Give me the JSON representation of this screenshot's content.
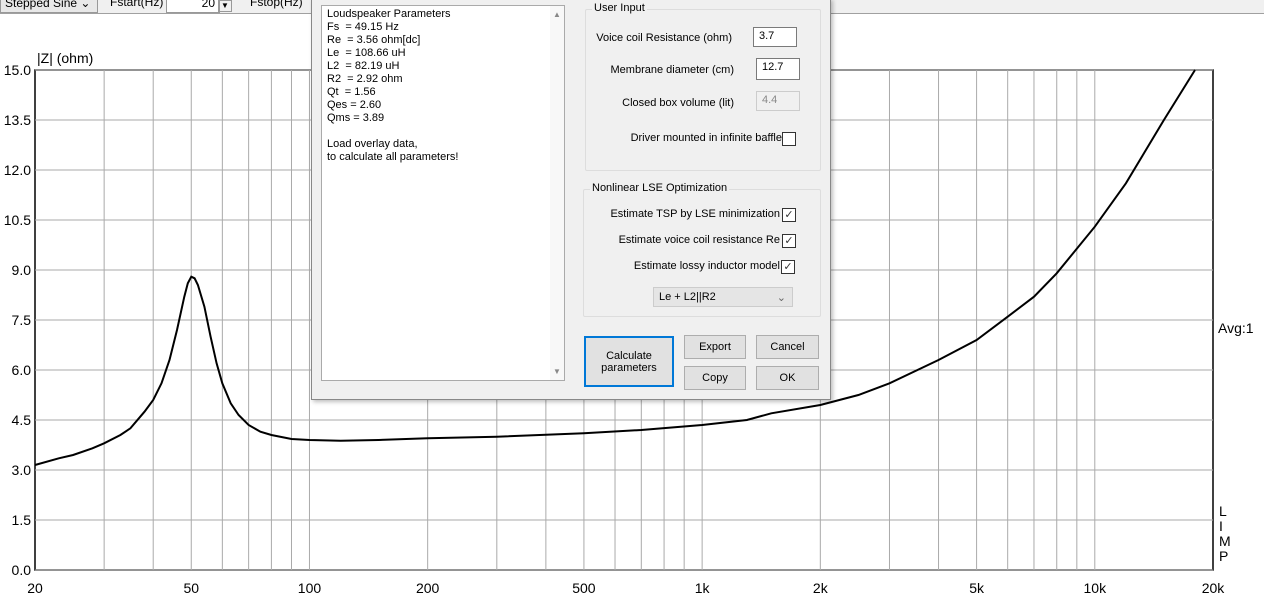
{
  "toolbar": {
    "mode": "Stepped Sine",
    "fstart_label": "Fstart(Hz)",
    "fstart_value": "20",
    "fstop_label": "Fstop(Hz)"
  },
  "chart_data": {
    "type": "line",
    "ylabel": "|Z| (ohm)",
    "xscale": "log",
    "xlim": [
      20,
      20000
    ],
    "ylim": [
      0,
      15
    ],
    "yticks": [
      "0.0",
      "1.5",
      "3.0",
      "4.5",
      "6.0",
      "7.5",
      "9.0",
      "10.5",
      "12.0",
      "13.5",
      "15.0"
    ],
    "xticks": [
      {
        "v": 20,
        "l": "20"
      },
      {
        "v": 50,
        "l": "50"
      },
      {
        "v": 100,
        "l": "100"
      },
      {
        "v": 200,
        "l": "200"
      },
      {
        "v": 500,
        "l": "500"
      },
      {
        "v": 1000,
        "l": "1k"
      },
      {
        "v": 2000,
        "l": "2k"
      },
      {
        "v": 5000,
        "l": "5k"
      },
      {
        "v": 10000,
        "l": "10k"
      },
      {
        "v": 20000,
        "l": "20k"
      }
    ],
    "grid": true,
    "right_label": "Avg:1",
    "side_label": [
      "L",
      "I",
      "M",
      "P"
    ],
    "series": [
      {
        "name": "impedance",
        "color": "#000000",
        "x": [
          20,
          23,
          25,
          28,
          30,
          33,
          35,
          38,
          40,
          42,
          44,
          46,
          48,
          49,
          50,
          51,
          52,
          54,
          56,
          58,
          60,
          63,
          66,
          70,
          75,
          80,
          90,
          100,
          120,
          150,
          200,
          300,
          500,
          700,
          1000,
          1300,
          1500,
          2000,
          2500,
          3000,
          4000,
          5000,
          6000,
          7000,
          8000,
          10000,
          12000,
          15000,
          18000
        ],
        "y": [
          3.15,
          3.35,
          3.45,
          3.65,
          3.8,
          4.05,
          4.25,
          4.75,
          5.1,
          5.6,
          6.3,
          7.2,
          8.2,
          8.6,
          8.8,
          8.75,
          8.55,
          7.9,
          7.0,
          6.2,
          5.6,
          5.0,
          4.65,
          4.35,
          4.15,
          4.05,
          3.93,
          3.9,
          3.88,
          3.9,
          3.95,
          4.0,
          4.1,
          4.2,
          4.35,
          4.5,
          4.7,
          4.95,
          5.25,
          5.6,
          6.3,
          6.9,
          7.6,
          8.2,
          8.9,
          10.3,
          11.6,
          13.5,
          15.0
        ]
      }
    ]
  },
  "dialog": {
    "memo": [
      "Loudspeaker Parameters",
      "Fs  = 49.15 Hz",
      "Re  = 3.56 ohm[dc]",
      "Le  = 108.66 uH",
      "L2  = 82.19 uH",
      "R2  = 2.92 ohm",
      "Qt  = 1.56",
      "Qes = 2.60",
      "Qms = 3.89",
      "",
      "Load overlay data,",
      "to calculate all parameters!"
    ],
    "user_input": {
      "title": "User Input",
      "vc_label": "Voice coil Resistance (ohm)",
      "vc_value": "3.7",
      "md_label": "Membrane diameter (cm)",
      "md_value": "12.7",
      "vol_label": "Closed box volume (lit)",
      "vol_value": "4.4",
      "baffle_label": "Driver mounted in infinite baffle"
    },
    "lse": {
      "title": "Nonlinear LSE Optimization",
      "tsp_label": "Estimate TSP by LSE minimization",
      "re_label": "Estimate voice coil resistance Re",
      "lossy_label": "Estimate lossy inductor model",
      "model": "Le + L2||R2"
    },
    "buttons": {
      "calc": "Calculate parameters",
      "export": "Export",
      "cancel": "Cancel",
      "copy": "Copy",
      "ok": "OK"
    }
  }
}
